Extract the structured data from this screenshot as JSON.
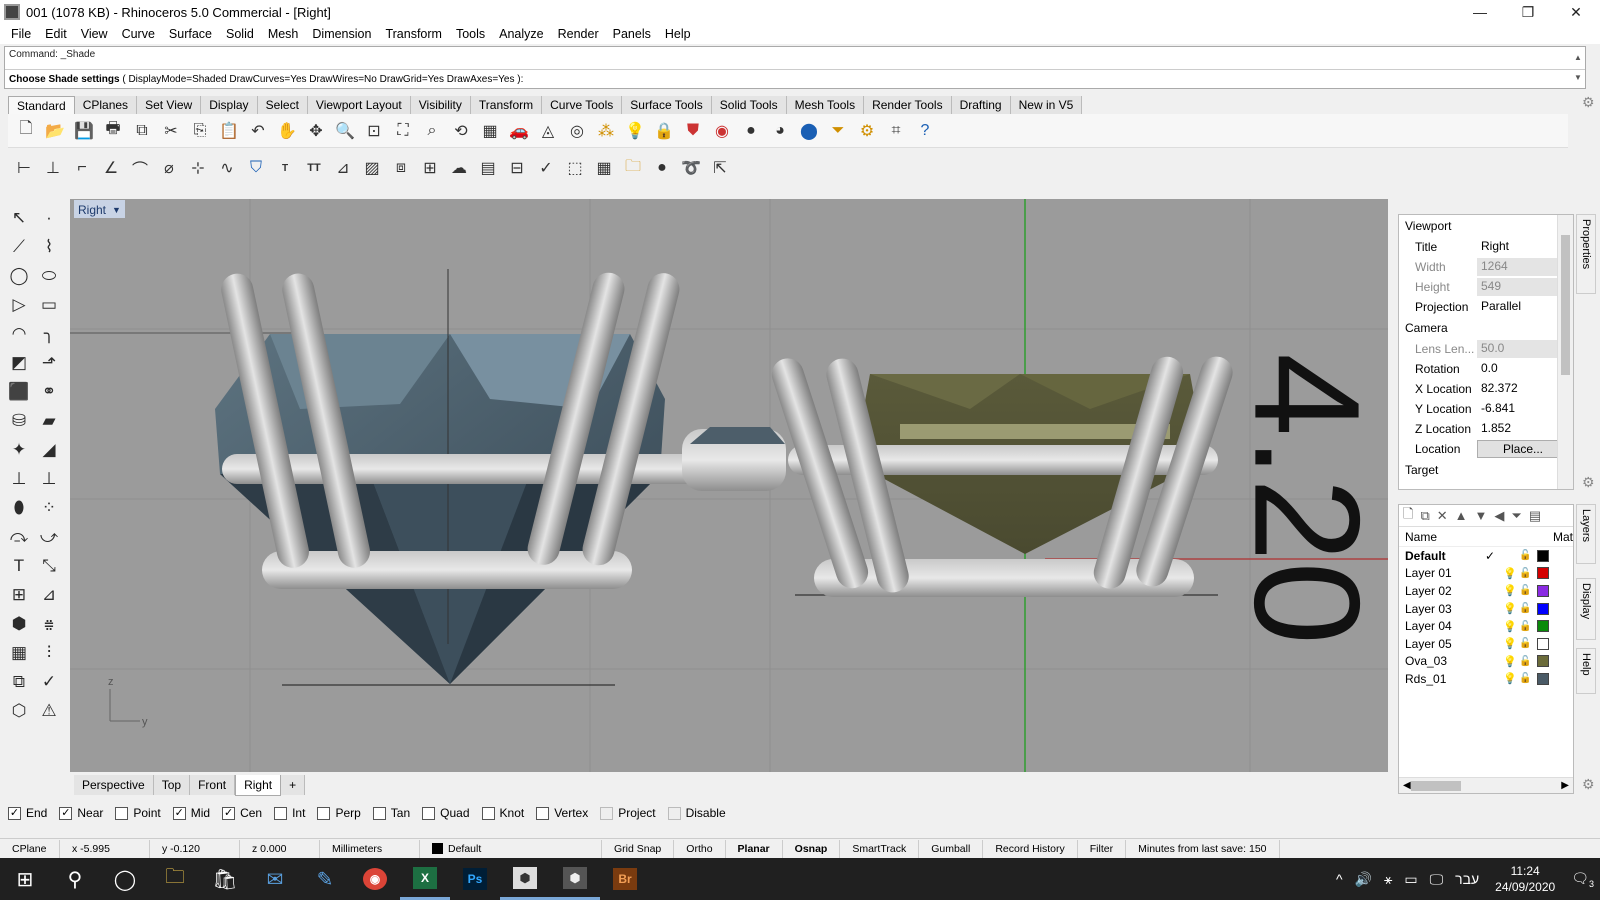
{
  "window": {
    "title": "001 (1078 KB) - Rhinoceros 5.0 Commercial - [Right]",
    "minimize": "—",
    "restore": "❐",
    "close": "✕"
  },
  "menu": [
    "File",
    "Edit",
    "View",
    "Curve",
    "Surface",
    "Solid",
    "Mesh",
    "Dimension",
    "Transform",
    "Tools",
    "Analyze",
    "Render",
    "Panels",
    "Help"
  ],
  "command": {
    "history": "Command: _Shade",
    "prompt_bold": "Choose Shade settings",
    "prompt_rest": " ( DisplayMode=Shaded  DrawCurves=Yes  DrawWires=No  DrawGrid=Yes  DrawAxes=Yes ):"
  },
  "toolbar_tabs": [
    "Standard",
    "CPlanes",
    "Set View",
    "Display",
    "Select",
    "Viewport Layout",
    "Visibility",
    "Transform",
    "Curve Tools",
    "Surface Tools",
    "Solid Tools",
    "Mesh Tools",
    "Render Tools",
    "Drafting",
    "New in V5"
  ],
  "active_toolbar_tab": "Standard",
  "viewport": {
    "name": "Right",
    "dim_text": "4.20",
    "axis_z": "z",
    "axis_y": "y"
  },
  "viewport_tabs": [
    "Perspective",
    "Top",
    "Front",
    "Right"
  ],
  "viewport_tab_add": "+",
  "active_viewport_tab": "Right",
  "osnaps": [
    {
      "label": "End",
      "checked": true
    },
    {
      "label": "Near",
      "checked": true
    },
    {
      "label": "Point",
      "checked": false
    },
    {
      "label": "Mid",
      "checked": true
    },
    {
      "label": "Cen",
      "checked": true
    },
    {
      "label": "Int",
      "checked": false
    },
    {
      "label": "Perp",
      "checked": false
    },
    {
      "label": "Tan",
      "checked": false
    },
    {
      "label": "Quad",
      "checked": false
    },
    {
      "label": "Knot",
      "checked": false
    },
    {
      "label": "Vertex",
      "checked": false
    },
    {
      "label": "Project",
      "checked": false,
      "disabled": true
    },
    {
      "label": "Disable",
      "checked": false,
      "disabled": true
    }
  ],
  "status": {
    "cplane": "CPlane",
    "x": "x -5.995",
    "y": "y -0.120",
    "z": "z 0.000",
    "units": "Millimeters",
    "layer": "Default",
    "grid_snap": "Grid Snap",
    "ortho": "Ortho",
    "planar": "Planar",
    "osnap": "Osnap",
    "smarttrack": "SmartTrack",
    "gumball": "Gumball",
    "record_history": "Record History",
    "filter": "Filter",
    "minutes": "Minutes from last save: 150"
  },
  "properties": {
    "section_viewport": "Viewport",
    "section_camera": "Camera",
    "section_target": "Target",
    "rows_viewport": [
      {
        "k": "Title",
        "v": "Right",
        "ro": false
      },
      {
        "k": "Width",
        "v": "1264",
        "ro": true
      },
      {
        "k": "Height",
        "v": "549",
        "ro": true
      },
      {
        "k": "Projection",
        "v": "Parallel",
        "ro": false,
        "dd": true
      }
    ],
    "rows_camera": [
      {
        "k": "Lens Len...",
        "v": "50.0",
        "ro": true
      },
      {
        "k": "Rotation",
        "v": "0.0",
        "ro": false
      },
      {
        "k": "X Location",
        "v": "82.372",
        "ro": false
      },
      {
        "k": "Y Location",
        "v": "-6.841",
        "ro": false
      },
      {
        "k": "Z Location",
        "v": "1.852",
        "ro": false
      },
      {
        "k": "Location",
        "v": "Place...",
        "btn": true
      }
    ],
    "tab_label": "Properties"
  },
  "layers": {
    "header_name": "Name",
    "header_mat": "Mat",
    "tab_label": "Layers",
    "items": [
      {
        "name": "Default",
        "current": true,
        "color": "#000000"
      },
      {
        "name": "Layer 01",
        "color": "#d40000"
      },
      {
        "name": "Layer 02",
        "color": "#8a2be2"
      },
      {
        "name": "Layer 03",
        "color": "#0000ff"
      },
      {
        "name": "Layer 04",
        "color": "#0a8a0a"
      },
      {
        "name": "Layer 05",
        "color": "#ffffff"
      },
      {
        "name": "Ova_03",
        "color": "#6b6b3a"
      },
      {
        "name": "Rds_01",
        "color": "#4a5a66"
      }
    ]
  },
  "side_tabs": {
    "display": "Display",
    "help": "Help"
  },
  "taskbar": {
    "time": "11:24",
    "date": "24/09/2020",
    "lang": "עבר",
    "notif_count": "3"
  }
}
